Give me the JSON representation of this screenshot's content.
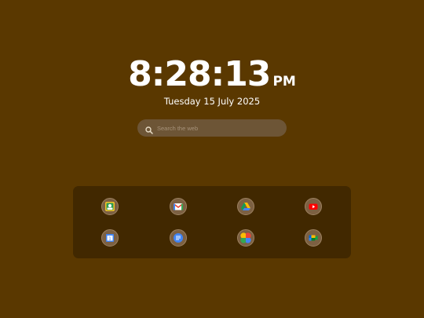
{
  "clock": {
    "time": "8:28:13",
    "ampm": "PM"
  },
  "date": "Tuesday 15 July 2025",
  "search": {
    "placeholder": "Search the web",
    "value": ""
  },
  "shortcuts": [
    {
      "icon": "google-photos-icon"
    },
    {
      "icon": "gmail-icon"
    },
    {
      "icon": "google-drive-icon"
    },
    {
      "icon": "youtube-icon"
    },
    {
      "icon": "google-calendar-icon"
    },
    {
      "icon": "google-docs-icon"
    },
    {
      "icon": "google-photos-pinwheel-icon"
    },
    {
      "icon": "google-meet-icon"
    }
  ],
  "colors": {
    "background": "#5a3800",
    "panel": "#412800",
    "search_bg": "#6d5536",
    "text": "#ffffff"
  }
}
